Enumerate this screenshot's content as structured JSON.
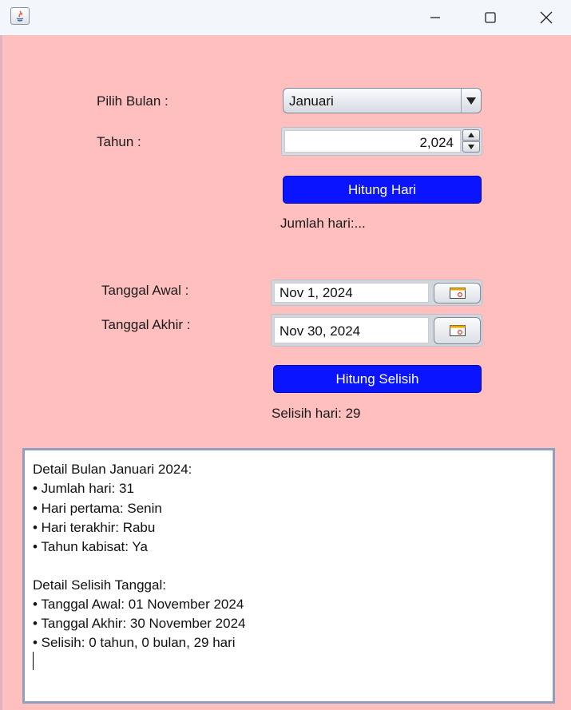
{
  "window": {
    "icon": "java-icon",
    "controls": [
      "minimize-icon",
      "maximize-icon",
      "close-icon"
    ]
  },
  "colors": {
    "background": "#ffbfbf",
    "button": "#0a14ff",
    "button_text": "#ffffff"
  },
  "form": {
    "bulan_label": "Pilih Bulan :",
    "bulan_value": "Januari",
    "tahun_label": "Tahun :",
    "tahun_value": "2,024",
    "hitung_hari_label": "Hitung Hari",
    "jumlah_hari_text": "Jumlah hari:...",
    "tanggal_awal_label": "Tanggal Awal :",
    "tanggal_awal_value": "Nov 1, 2024",
    "tanggal_akhir_label": "Tanggal Akhir :",
    "tanggal_akhir_value": "Nov 30, 2024",
    "hitung_selisih_label": "Hitung Selisih",
    "selisih_text": "Selisih hari: 29"
  },
  "output": {
    "lines": [
      "Detail Bulan Januari 2024:",
      "• Jumlah hari: 31",
      "• Hari pertama: Senin",
      "• Hari terakhir: Rabu",
      "• Tahun kabisat: Ya",
      "",
      "Detail Selisih Tanggal:",
      "• Tanggal Awal: 01 November 2024",
      "• Tanggal Akhir: 30 November 2024",
      "• Selisih: 0 tahun, 0 bulan, 29 hari"
    ]
  }
}
